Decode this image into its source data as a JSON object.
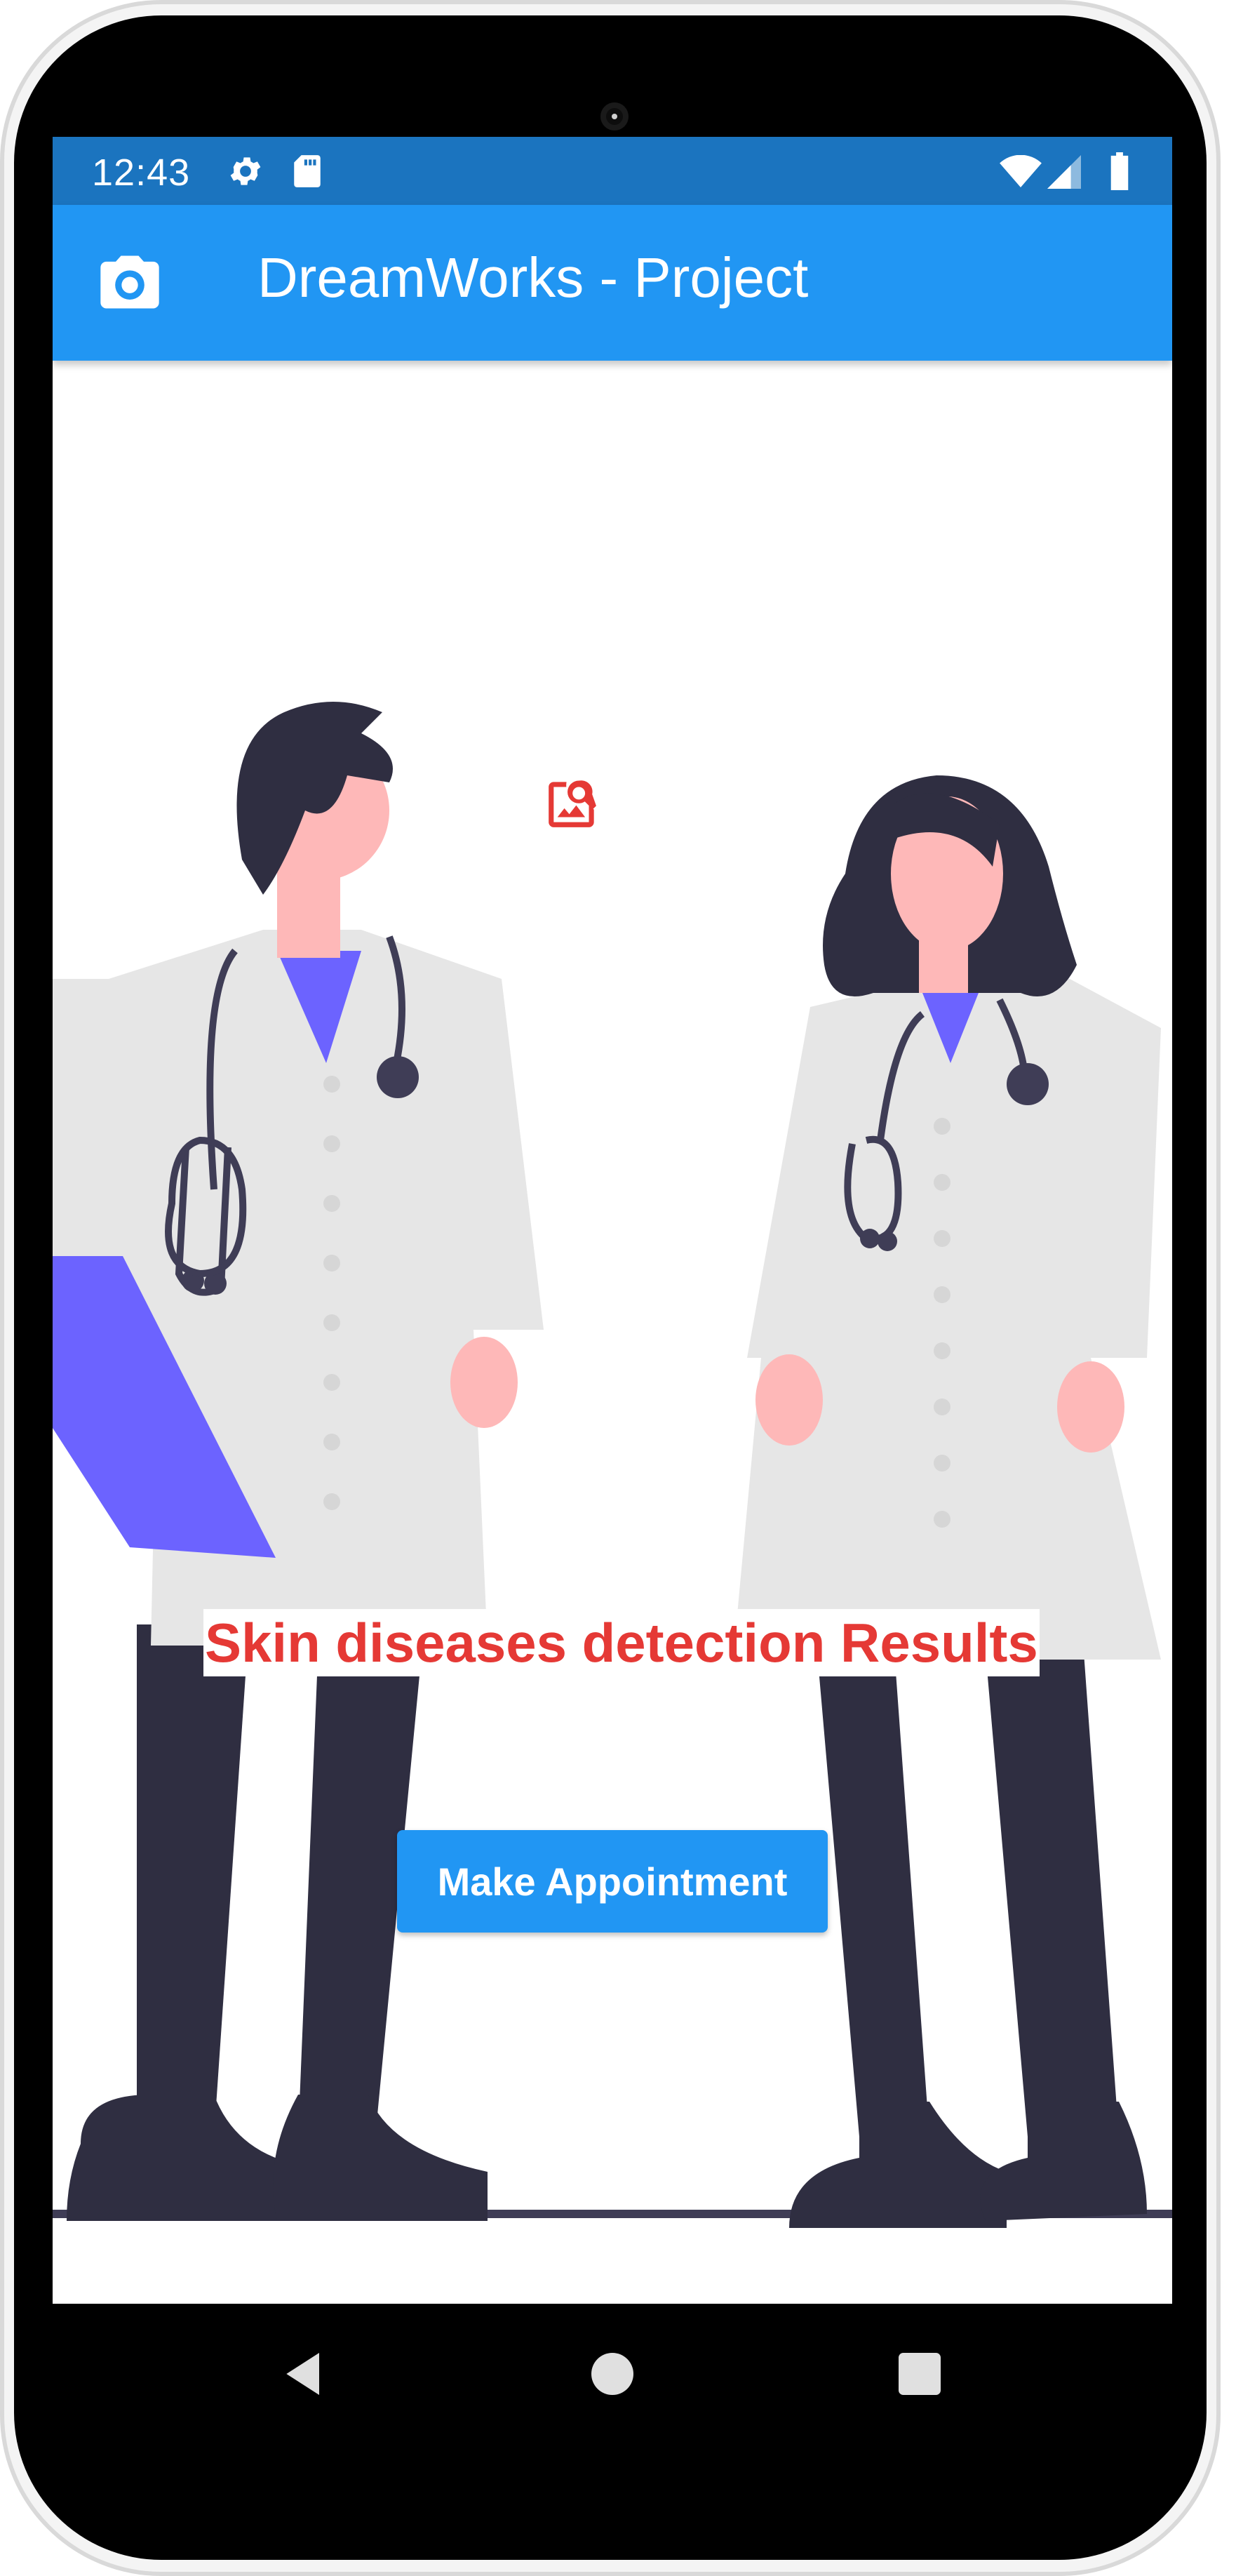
{
  "status_bar": {
    "time": "12:43",
    "icons": [
      "settings-icon",
      "sd-card-icon",
      "wifi-icon",
      "signal-icon",
      "battery-icon"
    ]
  },
  "app_bar": {
    "title": "DreamWorks - Project",
    "leading_icon": "camera-icon",
    "background_color": "#2196f3"
  },
  "content": {
    "image_icon": "image-search-icon",
    "result_title": "Skin diseases detection Results",
    "result_title_color": "#e53935",
    "appointment_button_label": "Make Appointment"
  },
  "nav_bar": {
    "items": [
      "back-icon",
      "home-icon",
      "recents-icon"
    ]
  }
}
